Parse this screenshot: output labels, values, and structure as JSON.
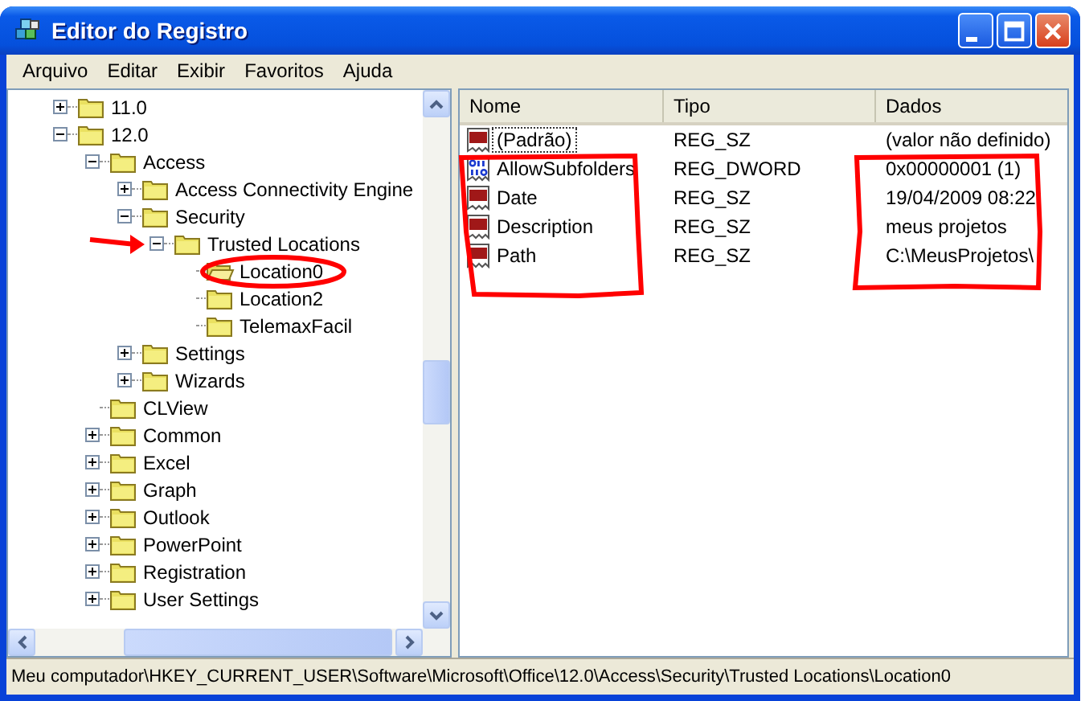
{
  "window": {
    "title": "Editor do Registro"
  },
  "menu": [
    "Arquivo",
    "Editar",
    "Exibir",
    "Favoritos",
    "Ajuda"
  ],
  "tree": [
    {
      "label": "11.0",
      "expanded": false,
      "selected": false
    },
    {
      "label": "12.0",
      "expanded": true,
      "selected": false,
      "children": [
        {
          "label": "Access",
          "expanded": true,
          "selected": false,
          "children": [
            {
              "label": "Access Connectivity Engine",
              "expanded": false,
              "selected": false
            },
            {
              "label": "Security",
              "expanded": true,
              "selected": false,
              "children": [
                {
                  "label": "Trusted Locations",
                  "expanded": true,
                  "selected": false,
                  "children": [
                    {
                      "label": "Location0",
                      "selected": true
                    },
                    {
                      "label": "Location2",
                      "selected": false
                    },
                    {
                      "label": "TelemaxFacil",
                      "selected": false
                    }
                  ]
                }
              ]
            },
            {
              "label": "Settings",
              "expanded": false,
              "selected": false
            },
            {
              "label": "Wizards",
              "expanded": false,
              "selected": false
            }
          ]
        },
        {
          "label": "CLView",
          "selected": false
        },
        {
          "label": "Common",
          "expanded": false,
          "selected": false
        },
        {
          "label": "Excel",
          "expanded": false,
          "selected": false
        },
        {
          "label": "Graph",
          "expanded": false,
          "selected": false
        },
        {
          "label": "Outlook",
          "expanded": false,
          "selected": false
        },
        {
          "label": "PowerPoint",
          "expanded": false,
          "selected": false
        },
        {
          "label": "Registration",
          "expanded": false,
          "selected": false
        },
        {
          "label": "User Settings",
          "expanded": false,
          "selected": false
        }
      ]
    }
  ],
  "table": {
    "columns": [
      "Nome",
      "Tipo",
      "Dados"
    ],
    "rows": [
      {
        "kind": "string",
        "name": "(Padrão)",
        "type": "REG_SZ",
        "data": "(valor não definido)",
        "focused": true
      },
      {
        "kind": "dword",
        "name": "AllowSubfolders",
        "type": "REG_DWORD",
        "data": "0x00000001 (1)",
        "focused": false
      },
      {
        "kind": "string",
        "name": "Date",
        "type": "REG_SZ",
        "data": "19/04/2009 08:22",
        "focused": false
      },
      {
        "kind": "string",
        "name": "Description",
        "type": "REG_SZ",
        "data": "meus projetos",
        "focused": false
      },
      {
        "kind": "string",
        "name": "Path",
        "type": "REG_SZ",
        "data": "C:\\MeusProjetos\\",
        "focused": false
      }
    ]
  },
  "status_bar": "Meu computador\\HKEY_CURRENT_USER\\Software\\Microsoft\\Office\\12.0\\Access\\Security\\Trusted Locations\\Location0"
}
